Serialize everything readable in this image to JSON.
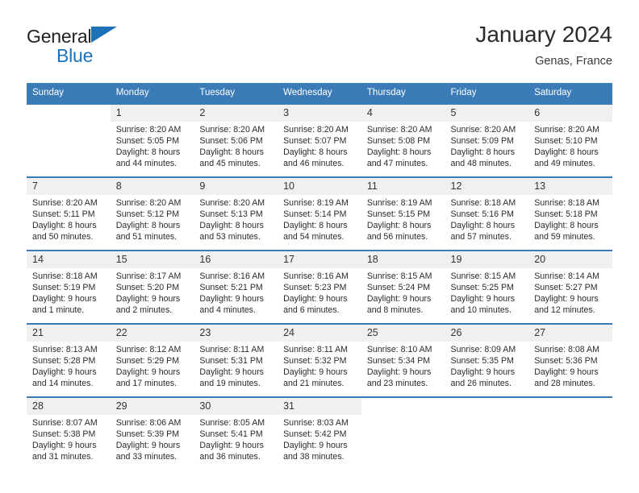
{
  "brand": {
    "name_dark": "General",
    "name_blue": "Blue",
    "triangle_color": "#1d71b8"
  },
  "header": {
    "title": "January 2024",
    "subtitle": "Genas, France"
  },
  "theme": {
    "header_blue": "#3b7cb8",
    "daynum_band": "#f0f0f0",
    "text": "#2b2b2b"
  },
  "calendar": {
    "weekday_headers": [
      "Sunday",
      "Monday",
      "Tuesday",
      "Wednesday",
      "Thursday",
      "Friday",
      "Saturday"
    ],
    "weeks": [
      [
        {
          "day": "",
          "sunrise": "",
          "sunset": "",
          "daylight": "",
          "blank": true
        },
        {
          "day": "1",
          "sunrise": "Sunrise: 8:20 AM",
          "sunset": "Sunset: 5:05 PM",
          "daylight": "Daylight: 8 hours and 44 minutes."
        },
        {
          "day": "2",
          "sunrise": "Sunrise: 8:20 AM",
          "sunset": "Sunset: 5:06 PM",
          "daylight": "Daylight: 8 hours and 45 minutes."
        },
        {
          "day": "3",
          "sunrise": "Sunrise: 8:20 AM",
          "sunset": "Sunset: 5:07 PM",
          "daylight": "Daylight: 8 hours and 46 minutes."
        },
        {
          "day": "4",
          "sunrise": "Sunrise: 8:20 AM",
          "sunset": "Sunset: 5:08 PM",
          "daylight": "Daylight: 8 hours and 47 minutes."
        },
        {
          "day": "5",
          "sunrise": "Sunrise: 8:20 AM",
          "sunset": "Sunset: 5:09 PM",
          "daylight": "Daylight: 8 hours and 48 minutes."
        },
        {
          "day": "6",
          "sunrise": "Sunrise: 8:20 AM",
          "sunset": "Sunset: 5:10 PM",
          "daylight": "Daylight: 8 hours and 49 minutes."
        }
      ],
      [
        {
          "day": "7",
          "sunrise": "Sunrise: 8:20 AM",
          "sunset": "Sunset: 5:11 PM",
          "daylight": "Daylight: 8 hours and 50 minutes."
        },
        {
          "day": "8",
          "sunrise": "Sunrise: 8:20 AM",
          "sunset": "Sunset: 5:12 PM",
          "daylight": "Daylight: 8 hours and 51 minutes."
        },
        {
          "day": "9",
          "sunrise": "Sunrise: 8:20 AM",
          "sunset": "Sunset: 5:13 PM",
          "daylight": "Daylight: 8 hours and 53 minutes."
        },
        {
          "day": "10",
          "sunrise": "Sunrise: 8:19 AM",
          "sunset": "Sunset: 5:14 PM",
          "daylight": "Daylight: 8 hours and 54 minutes."
        },
        {
          "day": "11",
          "sunrise": "Sunrise: 8:19 AM",
          "sunset": "Sunset: 5:15 PM",
          "daylight": "Daylight: 8 hours and 56 minutes."
        },
        {
          "day": "12",
          "sunrise": "Sunrise: 8:18 AM",
          "sunset": "Sunset: 5:16 PM",
          "daylight": "Daylight: 8 hours and 57 minutes."
        },
        {
          "day": "13",
          "sunrise": "Sunrise: 8:18 AM",
          "sunset": "Sunset: 5:18 PM",
          "daylight": "Daylight: 8 hours and 59 minutes."
        }
      ],
      [
        {
          "day": "14",
          "sunrise": "Sunrise: 8:18 AM",
          "sunset": "Sunset: 5:19 PM",
          "daylight": "Daylight: 9 hours and 1 minute."
        },
        {
          "day": "15",
          "sunrise": "Sunrise: 8:17 AM",
          "sunset": "Sunset: 5:20 PM",
          "daylight": "Daylight: 9 hours and 2 minutes."
        },
        {
          "day": "16",
          "sunrise": "Sunrise: 8:16 AM",
          "sunset": "Sunset: 5:21 PM",
          "daylight": "Daylight: 9 hours and 4 minutes."
        },
        {
          "day": "17",
          "sunrise": "Sunrise: 8:16 AM",
          "sunset": "Sunset: 5:23 PM",
          "daylight": "Daylight: 9 hours and 6 minutes."
        },
        {
          "day": "18",
          "sunrise": "Sunrise: 8:15 AM",
          "sunset": "Sunset: 5:24 PM",
          "daylight": "Daylight: 9 hours and 8 minutes."
        },
        {
          "day": "19",
          "sunrise": "Sunrise: 8:15 AM",
          "sunset": "Sunset: 5:25 PM",
          "daylight": "Daylight: 9 hours and 10 minutes."
        },
        {
          "day": "20",
          "sunrise": "Sunrise: 8:14 AM",
          "sunset": "Sunset: 5:27 PM",
          "daylight": "Daylight: 9 hours and 12 minutes."
        }
      ],
      [
        {
          "day": "21",
          "sunrise": "Sunrise: 8:13 AM",
          "sunset": "Sunset: 5:28 PM",
          "daylight": "Daylight: 9 hours and 14 minutes."
        },
        {
          "day": "22",
          "sunrise": "Sunrise: 8:12 AM",
          "sunset": "Sunset: 5:29 PM",
          "daylight": "Daylight: 9 hours and 17 minutes."
        },
        {
          "day": "23",
          "sunrise": "Sunrise: 8:11 AM",
          "sunset": "Sunset: 5:31 PM",
          "daylight": "Daylight: 9 hours and 19 minutes."
        },
        {
          "day": "24",
          "sunrise": "Sunrise: 8:11 AM",
          "sunset": "Sunset: 5:32 PM",
          "daylight": "Daylight: 9 hours and 21 minutes."
        },
        {
          "day": "25",
          "sunrise": "Sunrise: 8:10 AM",
          "sunset": "Sunset: 5:34 PM",
          "daylight": "Daylight: 9 hours and 23 minutes."
        },
        {
          "day": "26",
          "sunrise": "Sunrise: 8:09 AM",
          "sunset": "Sunset: 5:35 PM",
          "daylight": "Daylight: 9 hours and 26 minutes."
        },
        {
          "day": "27",
          "sunrise": "Sunrise: 8:08 AM",
          "sunset": "Sunset: 5:36 PM",
          "daylight": "Daylight: 9 hours and 28 minutes."
        }
      ],
      [
        {
          "day": "28",
          "sunrise": "Sunrise: 8:07 AM",
          "sunset": "Sunset: 5:38 PM",
          "daylight": "Daylight: 9 hours and 31 minutes."
        },
        {
          "day": "29",
          "sunrise": "Sunrise: 8:06 AM",
          "sunset": "Sunset: 5:39 PM",
          "daylight": "Daylight: 9 hours and 33 minutes."
        },
        {
          "day": "30",
          "sunrise": "Sunrise: 8:05 AM",
          "sunset": "Sunset: 5:41 PM",
          "daylight": "Daylight: 9 hours and 36 minutes."
        },
        {
          "day": "31",
          "sunrise": "Sunrise: 8:03 AM",
          "sunset": "Sunset: 5:42 PM",
          "daylight": "Daylight: 9 hours and 38 minutes."
        },
        {
          "day": "",
          "sunrise": "",
          "sunset": "",
          "daylight": "",
          "blank": true
        },
        {
          "day": "",
          "sunrise": "",
          "sunset": "",
          "daylight": "",
          "blank": true
        },
        {
          "day": "",
          "sunrise": "",
          "sunset": "",
          "daylight": "",
          "blank": true
        }
      ]
    ]
  }
}
